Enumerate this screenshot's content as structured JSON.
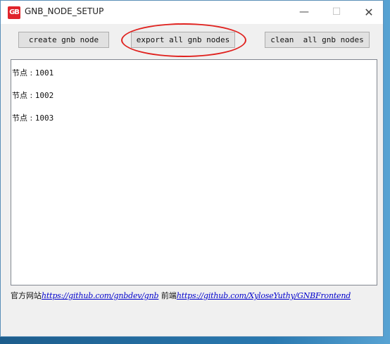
{
  "window": {
    "title": "GNB_NODE_SETUP",
    "icon_text": "GB",
    "controls": {
      "minimize": "—",
      "maximize": "☐",
      "close": "✕"
    }
  },
  "toolbar": {
    "create_label": "create gnb node",
    "export_label": "export all gnb nodes",
    "clean_label": "clean  all gnb nodes"
  },
  "output": {
    "nodes": [
      {
        "prefix": "节点 : ",
        "id": "1001"
      },
      {
        "prefix": "节点 : ",
        "id": "1002"
      },
      {
        "prefix": "节点 : ",
        "id": "1003"
      }
    ]
  },
  "footer": {
    "site_label": "官方网站",
    "site_url": "https://github.com/gnbdev/gnb",
    "frontend_label": " 前端",
    "frontend_url": "https://github.com/XyloseYuthy/GNBFrontend"
  },
  "colors": {
    "highlight": "#e0221f",
    "link": "#0000cc",
    "icon_bg": "#e0242b"
  }
}
